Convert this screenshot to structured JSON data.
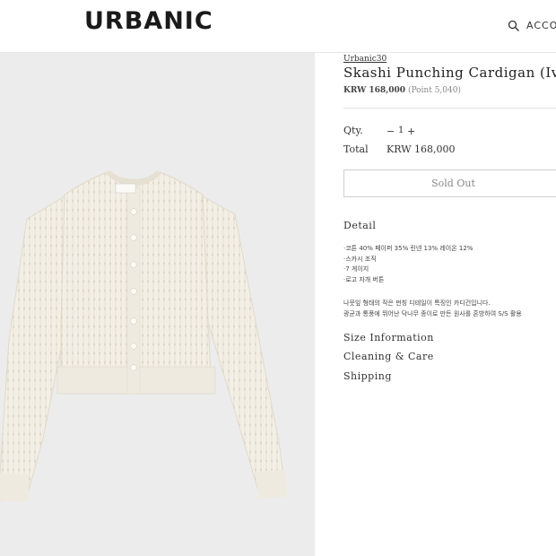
{
  "header": {
    "logo": "URBANIC",
    "account_label": "ACCOU"
  },
  "product": {
    "brand": "Urbanic30",
    "title": "Skashi Punching Cardigan (Ivo",
    "price": "KRW 168,000",
    "points": "(Point 5,040)",
    "qty_label": "Qty.",
    "qty_minus": "−",
    "qty_value": "1",
    "qty_plus": "+",
    "total_label": "Total",
    "total_value": "KRW 168,000",
    "soldout_label": "Sold Out"
  },
  "detail": {
    "title": "Detail",
    "specs": [
      "·코튼 40% 페이퍼 35% 린넨 13% 레이온 12%",
      "·스카시 조직",
      "·7 게이지",
      "·로고 자개 버튼"
    ],
    "description": [
      "나뭇잎 형태의 작은 펀칭 디테일이 특징인 카디건입니다.",
      "광균과 통풍에 뛰어난 닥나무 종이로 만든 원사를 혼방하여 S/S 활용"
    ]
  },
  "accordion": {
    "size": "Size Information",
    "care": "Cleaning & Care",
    "shipping": "Shipping"
  },
  "colors": {
    "image_bg": "#ececec",
    "garment": "#f3efe6",
    "button_text": "#888888"
  }
}
